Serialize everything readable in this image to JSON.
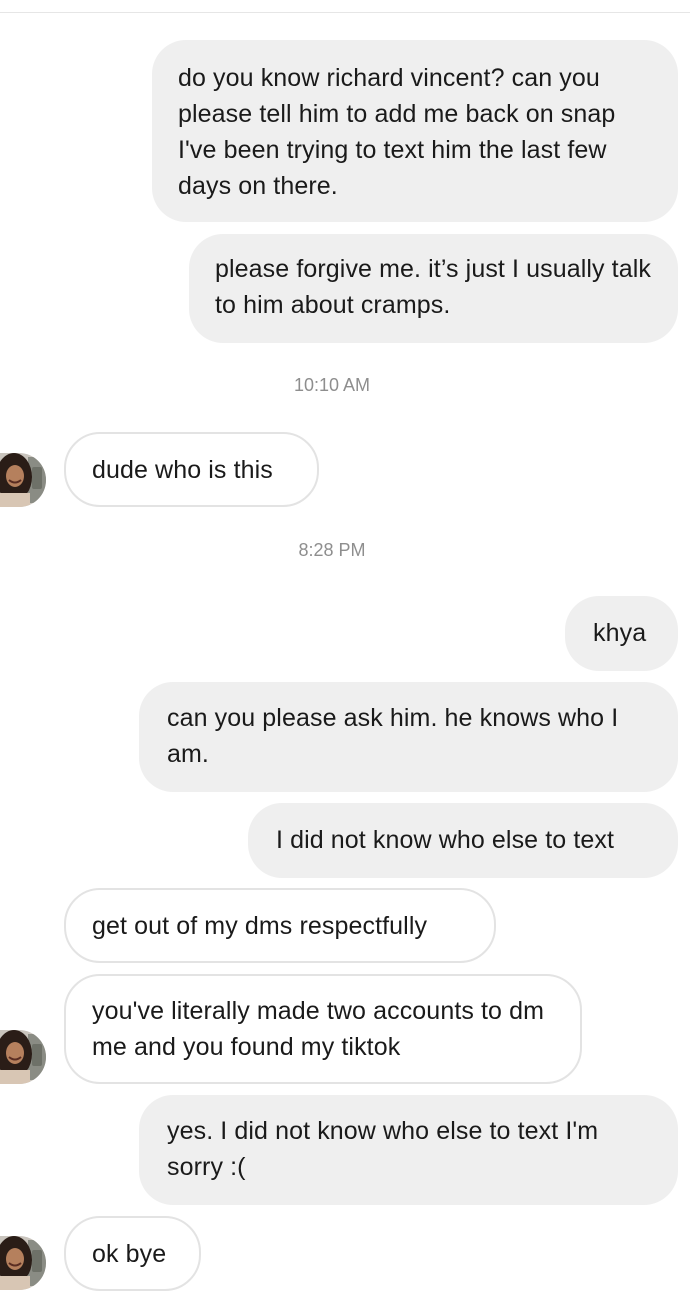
{
  "conversation": {
    "messages": [
      {
        "direction": "sent",
        "text": "do you know richard vincent? can you please tell him to add me back on snap I've been trying to text him the last few days on there."
      },
      {
        "direction": "sent",
        "text": "please forgive me. it’s just I usually talk to him about cramps."
      },
      {
        "timestamp": "10:10 AM"
      },
      {
        "direction": "received",
        "text": "dude who is this"
      },
      {
        "timestamp": "8:28 PM"
      },
      {
        "direction": "sent",
        "text": "khya"
      },
      {
        "direction": "sent",
        "text": "can you please ask him. he knows who I am."
      },
      {
        "direction": "sent",
        "text": "I did not know who else to text"
      },
      {
        "direction": "received",
        "text": "get out of my dms respectfully"
      },
      {
        "direction": "received",
        "text": "you've literally made two accounts to dm me and you found my tiktok"
      },
      {
        "direction": "sent",
        "text": "yes. I did not know who else to text I'm sorry :("
      },
      {
        "direction": "received",
        "text": "ok bye"
      }
    ]
  },
  "colors": {
    "sent_bubble": "#efefef",
    "received_border": "#e3e3e3",
    "timestamp": "#8e8e8e"
  },
  "icons": {
    "avatar": "contact-avatar"
  }
}
